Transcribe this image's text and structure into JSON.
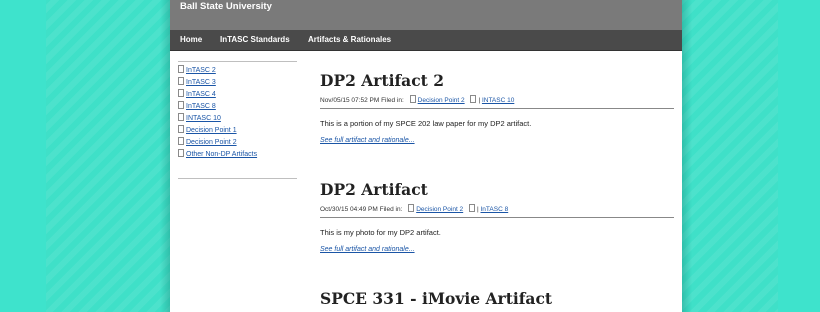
{
  "site": {
    "title": "Ball State University"
  },
  "nav": {
    "items": [
      {
        "label": "Home"
      },
      {
        "label": "InTASC Standards"
      },
      {
        "label": "Artifacts & Rationales"
      }
    ]
  },
  "sidebar": {
    "categories": [
      {
        "label": "InTASC 2"
      },
      {
        "label": "InTASC 3"
      },
      {
        "label": "InTASC 4"
      },
      {
        "label": "InTASC 8"
      },
      {
        "label": "INTASC 10"
      },
      {
        "label": "Decision Point 1"
      },
      {
        "label": "Decision Point 2"
      },
      {
        "label": "Other Non-DP Artifacts"
      }
    ]
  },
  "posts": [
    {
      "title": "DP2 Artifact 2",
      "meta_date": "Nov/05/15 07:52 PM Filed in:",
      "tag1": "Decision Point 2",
      "tag2": "INTASC 10",
      "body": "This is a portion of my SPCE 202 law paper for my DP2 artifact.",
      "more": "See full artifact and rationale..."
    },
    {
      "title": "DP2 Artifact",
      "meta_date": "Oct/30/15 04:49 PM Filed in:",
      "tag1": "Decision Point 2",
      "tag2": "InTASC 8",
      "body": "This is my photo for my DP2 artifact.",
      "more": "See full artifact and rationale..."
    },
    {
      "title": "SPCE 331 - iMovie Artifact"
    }
  ],
  "colors": {
    "background": "#3fe0c8",
    "header_gray": "#7a7a7a",
    "nav_dark": "#4a4a4a",
    "link_blue": "#1a55a6"
  },
  "icons": {
    "category": "document-icon"
  }
}
